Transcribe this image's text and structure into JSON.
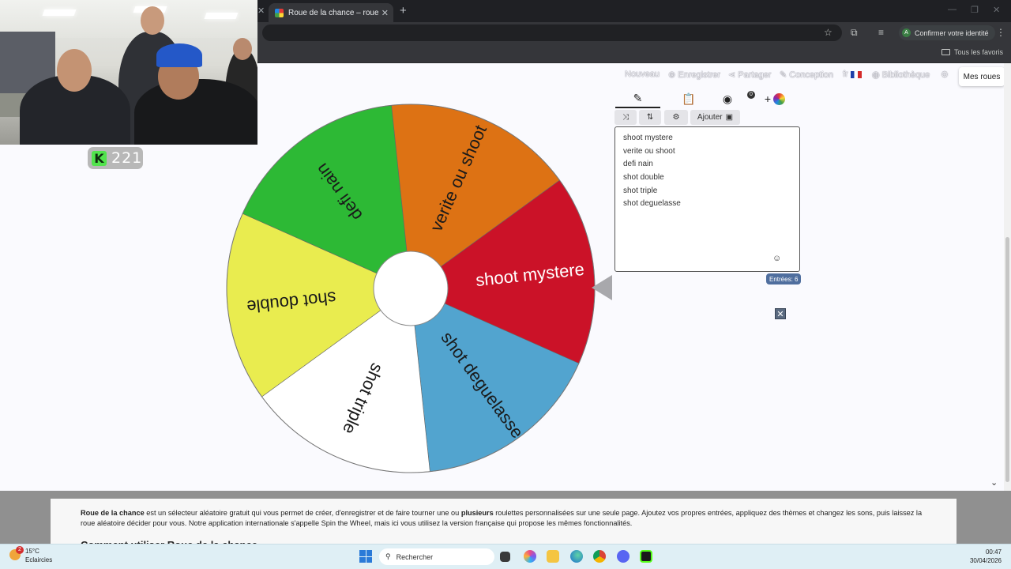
{
  "browser": {
    "tab_title": "Roue de la chance – roue aléat",
    "confirm_identity": "Confirmer votre identité",
    "bookmarks_label": "Tous les favoris"
  },
  "stream": {
    "viewer_count": "221",
    "k_logo": "K"
  },
  "nav": {
    "nouveau": "Nouveau",
    "enregistrer": "Enregistrer",
    "partager": "Partager",
    "conception": "Conception",
    "language": "fr",
    "bibliotheque": "Bibliothèque",
    "mes_roues": "Mes roues"
  },
  "wheel": {
    "segments": [
      {
        "label": "shoot mystere",
        "color": "#cb1228",
        "text_color": "#ffffff"
      },
      {
        "label": "shot deguelasse",
        "color": "#52a4cf",
        "text_color": "#1a1a1a"
      },
      {
        "label": "shot triple",
        "color": "#ffffff",
        "text_color": "#1a1a1a"
      },
      {
        "label": "shot double",
        "color": "#e9ec4f",
        "text_color": "#1a1a1a"
      },
      {
        "label": "defi nain",
        "color": "#2db935",
        "text_color": "#1a1a1a"
      },
      {
        "label": "verite ou shoot",
        "color": "#dd7214",
        "text_color": "#1a1a1a"
      }
    ]
  },
  "editor": {
    "add_label": "Ajouter",
    "results_badge": "0",
    "entries": [
      "shoot mystere",
      "verite ou shoot",
      "defi nain",
      "shot double",
      "shot triple",
      "shot deguelasse"
    ],
    "entries_count_label": "Entrées: 6",
    "close_glyph": "✕"
  },
  "description": {
    "brand": "Roue de la chance",
    "text_1": " est un sélecteur aléatoire gratuit qui vous permet de créer, d'enregistrer et de faire tourner une ou ",
    "bold_word": "plusieurs",
    "text_2": " roulettes personnalisées sur une seule page. Ajoutez vos propres entrées, appliquez des thèmes et changez les sons, puis laissez la roue aléatoire décider pour vous. Notre application internationale s'appelle Spin the Wheel, mais ici vous utilisez la version française qui propose les mêmes fonctionnalités.",
    "heading": "Comment utiliser Roue de la chance"
  },
  "taskbar": {
    "temperature": "15°C",
    "weather": "Eclaircies",
    "weather_badge": "2",
    "search_placeholder": "Rechercher",
    "time": "00:47",
    "date": "30/04/2026"
  }
}
